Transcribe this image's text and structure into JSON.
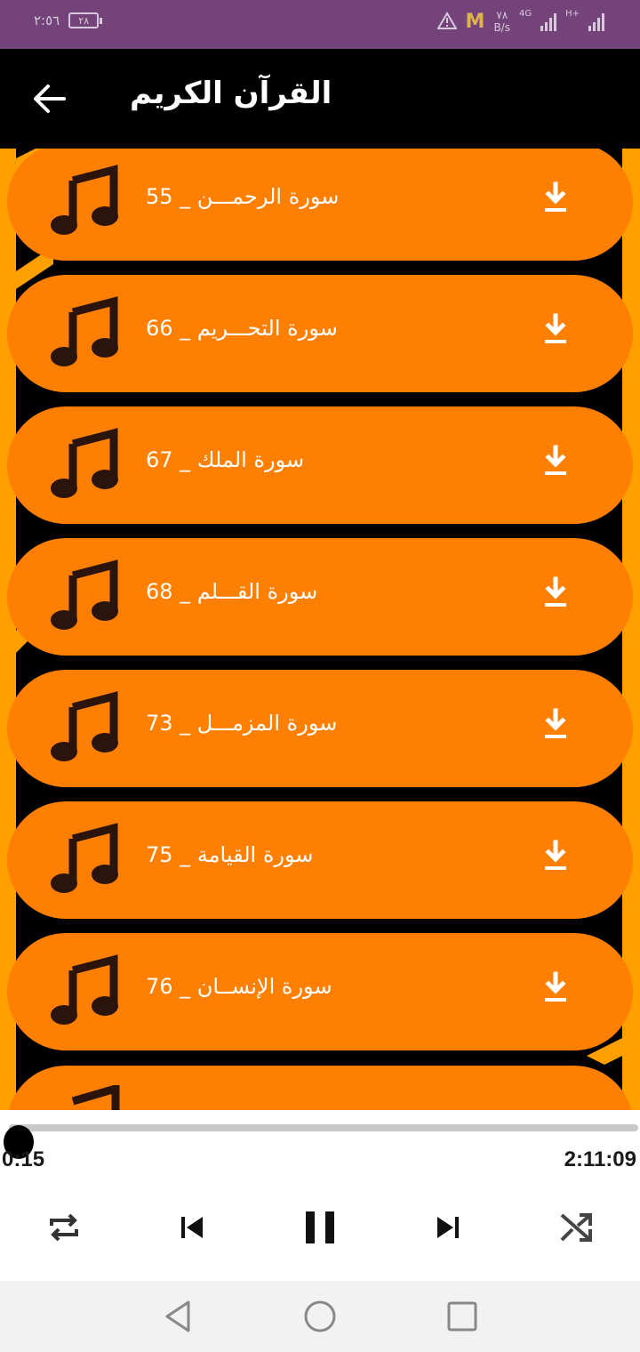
{
  "status_bar": {
    "time": "٢:٥٦",
    "battery": "٢٨",
    "net_speed_value": "٧٨",
    "net_speed_unit": "B/s",
    "network_type": "4G",
    "network_type2": "H+"
  },
  "app_bar": {
    "title": "القرآن الكريم",
    "back_icon": "arrow-left-icon"
  },
  "surahs": [
    {
      "label": "سورة الرحمـــن _ 55",
      "icon": "music-note-icon",
      "action_icon": "download-icon"
    },
    {
      "label": "سورة التحـــريم _ 66",
      "icon": "music-note-icon",
      "action_icon": "download-icon"
    },
    {
      "label": "سورة الملك _ 67",
      "icon": "music-note-icon",
      "action_icon": "download-icon"
    },
    {
      "label": "سورة القـــلم _ 68",
      "icon": "music-note-icon",
      "action_icon": "download-icon"
    },
    {
      "label": "سورة المزمـــل _ 73",
      "icon": "music-note-icon",
      "action_icon": "download-icon"
    },
    {
      "label": "سورة القيامة _ 75",
      "icon": "music-note-icon",
      "action_icon": "download-icon"
    },
    {
      "label": "سورة الإنســان _ 76",
      "icon": "music-note-icon",
      "action_icon": "download-icon"
    }
  ],
  "player": {
    "current_time": "0:15",
    "total_time": "2:11:09",
    "progress_fraction": 0.002,
    "controls": [
      "repeat-icon",
      "previous-icon",
      "pause-icon",
      "next-icon",
      "shuffle-icon"
    ]
  },
  "colors": {
    "status_bar": "#73437a",
    "app_bar": "#000000",
    "item": "#ff7f00",
    "deco_stripe": "#ffa000"
  }
}
